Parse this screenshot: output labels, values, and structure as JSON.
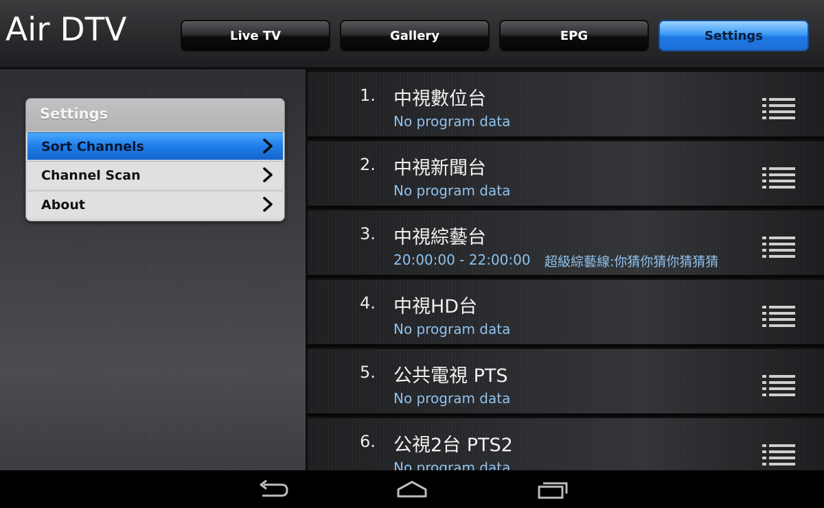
{
  "app": {
    "title": "Air DTV"
  },
  "tabs": [
    {
      "label": "Live TV",
      "active": false
    },
    {
      "label": "Gallery",
      "active": false
    },
    {
      "label": "EPG",
      "active": false
    },
    {
      "label": "Settings",
      "active": true
    }
  ],
  "settings_menu": {
    "title": "Settings",
    "items": [
      {
        "label": "Sort Channels",
        "selected": true,
        "icon": "chevron-right-icon"
      },
      {
        "label": "Channel Scan",
        "selected": false,
        "icon": "chevron-right-icon"
      },
      {
        "label": "About",
        "selected": false,
        "icon": "chevron-right-icon"
      }
    ]
  },
  "channels": [
    {
      "number": "1.",
      "name": "中視數位台",
      "program": "No program data",
      "icon": "drag-handle-icon"
    },
    {
      "number": "2.",
      "name": "中視新聞台",
      "program": "No program data",
      "icon": "drag-handle-icon"
    },
    {
      "number": "3.",
      "name": "中視綜藝台",
      "program_time": "20:00:00 - 22:00:00",
      "program_title": "超級綜藝線:你猜你猜你猜猜猜",
      "icon": "drag-handle-icon"
    },
    {
      "number": "4.",
      "name": "中視HD台",
      "program": "No program data",
      "icon": "drag-handle-icon"
    },
    {
      "number": "5.",
      "name": "公共電視 PTS",
      "program": "No program data",
      "icon": "drag-handle-icon"
    },
    {
      "number": "6.",
      "name": "公視2台 PTS2",
      "program": "No program data",
      "icon": "drag-handle-icon"
    }
  ],
  "navbar": {
    "icons": [
      "back-icon",
      "home-icon",
      "recent-apps-icon"
    ]
  },
  "colors": {
    "accent": "#1e7de8",
    "program_text": "#8fc2ee",
    "background": "#1e1f21"
  }
}
